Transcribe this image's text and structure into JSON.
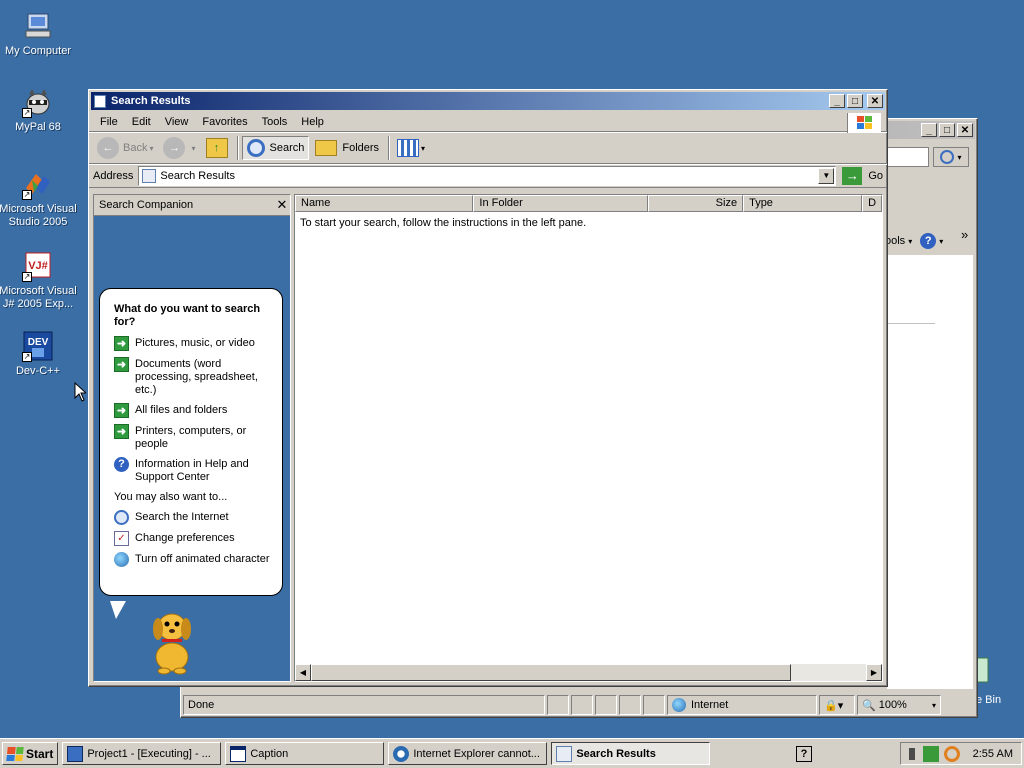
{
  "desktop": {
    "icons": [
      {
        "label": "My Computer"
      },
      {
        "label": "MyPal 68"
      },
      {
        "label": "Microsoft Visual Studio 2005"
      },
      {
        "label": "Microsoft Visual J# 2005 Exp..."
      },
      {
        "label": "Dev-C++"
      }
    ],
    "recycle_partial": "e Bin"
  },
  "back_window": {
    "toolbar_tools": "ools",
    "chevron": "»",
    "status": {
      "done": "Done",
      "zone": "Internet",
      "zoom": "100%"
    }
  },
  "search_window": {
    "title": "Search Results",
    "menu": [
      "File",
      "Edit",
      "View",
      "Favorites",
      "Tools",
      "Help"
    ],
    "toolbar": {
      "back": "Back",
      "search": "Search",
      "folders": "Folders"
    },
    "address": {
      "label": "Address",
      "value": "Search Results",
      "go": "Go"
    },
    "companion": {
      "title": "Search Companion",
      "question": "What do you want to search for?",
      "options": [
        "Pictures, music, or video",
        "Documents (word processing, spreadsheet, etc.)",
        "All files and folders",
        "Printers, computers, or people",
        "Information in Help and Support Center"
      ],
      "also_label": "You may also want to...",
      "also_options": [
        "Search the Internet",
        "Change preferences",
        "Turn off animated character"
      ]
    },
    "columns": [
      "Name",
      "In Folder",
      "Size",
      "Type",
      "D"
    ],
    "message": "To start your search, follow the instructions in the left pane."
  },
  "taskbar": {
    "start": "Start",
    "tasks": [
      "Project1 - [Executing] - ...",
      "Caption",
      "Internet Explorer cannot...",
      "Search Results"
    ],
    "clock": "2:55 AM"
  },
  "colors": {
    "desktop": "#3a6ea5",
    "titlebar_active": "#0a246a",
    "face": "#d4d0c8"
  }
}
